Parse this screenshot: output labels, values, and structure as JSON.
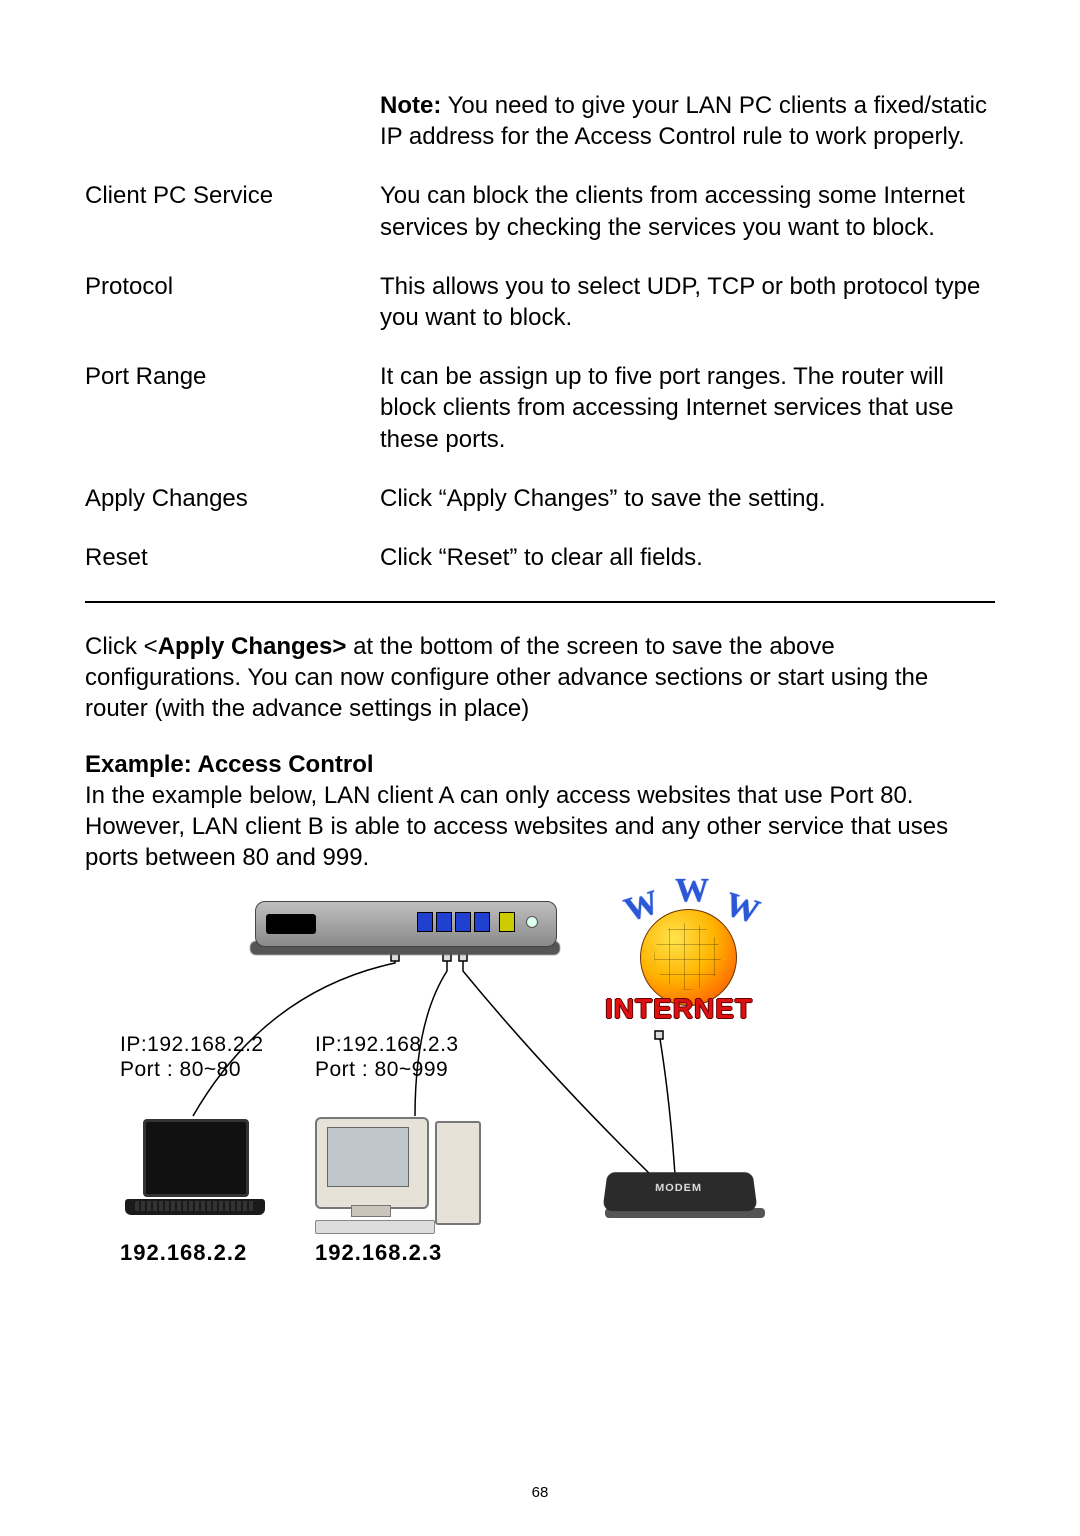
{
  "definitions": {
    "note_prefix": "Note:",
    "note_rest": " You need to give your LAN PC clients a fixed/static IP address for the Access Control rule to work properly.",
    "rows": [
      {
        "term": "Client PC Service",
        "desc": "You can block the clients from accessing some Internet services by checking the services you want to block."
      },
      {
        "term": "Protocol",
        "desc": "This allows you to select UDP, TCP or both protocol type you want to block."
      },
      {
        "term": "Port Range",
        "desc": "It can be assign up to five port ranges. The router will block clients from accessing Internet services that use these ports."
      },
      {
        "term": "Apply Changes",
        "desc": "Click “Apply Changes” to save the setting."
      },
      {
        "term": "Reset",
        "desc": "Click “Reset” to clear all fields."
      }
    ]
  },
  "after_table": {
    "pre": "Click <",
    "bold": "Apply Changes>",
    "post": " at the bottom of the screen to save the above configurations. You can now configure other advance sections or start using the router (with the advance settings in place)"
  },
  "example": {
    "heading": "Example: Access Control",
    "body": "In the example below, LAN client A can only access websites that use Port 80. However, LAN client B is able to access websites and any other service that uses ports between 80 and 999."
  },
  "diagram": {
    "clientA": {
      "ip_line": "IP:192.168.2.2",
      "port_line": "Port : 80~80",
      "addr": "192.168.2.2"
    },
    "clientB": {
      "ip_line": "IP:192.168.2.3",
      "port_line": "Port : 80~999",
      "addr": "192.168.2.3"
    },
    "internet_label": "INTERNET",
    "modem_label": "MODEM"
  },
  "page_number": "68"
}
